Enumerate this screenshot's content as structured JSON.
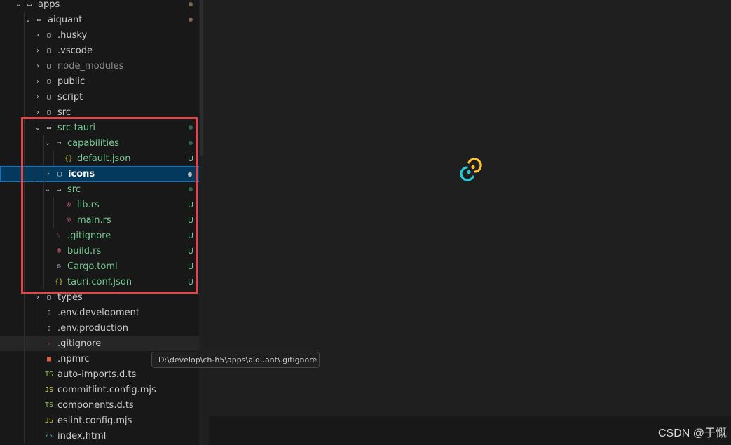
{
  "explorer": {
    "rows": [
      {
        "label": "apps",
        "twisty": "⌄",
        "kind": "folder-open",
        "status": "dot",
        "status_color": "#7a6a4f",
        "style": "normal"
      },
      {
        "label": "aiquant",
        "twisty": "⌄",
        "kind": "folder-open",
        "status": "dot",
        "status_color": "#7a6a4f",
        "style": "normal"
      },
      {
        "label": ".husky",
        "twisty": "›",
        "kind": "folder",
        "status": "",
        "style": "normal"
      },
      {
        "label": ".vscode",
        "twisty": "›",
        "kind": "folder",
        "status": "",
        "style": "normal"
      },
      {
        "label": "node_modules",
        "twisty": "›",
        "kind": "folder",
        "status": "",
        "style": "git-ignored"
      },
      {
        "label": "public",
        "twisty": "›",
        "kind": "folder",
        "status": "",
        "style": "normal"
      },
      {
        "label": "script",
        "twisty": "›",
        "kind": "folder",
        "status": "",
        "style": "normal"
      },
      {
        "label": "src",
        "twisty": "›",
        "kind": "folder",
        "status": "",
        "style": "normal"
      },
      {
        "label": "src-tauri",
        "twisty": "⌄",
        "kind": "folder-open",
        "status": "dot",
        "status_color": "#2f6a4a",
        "style": "git-u"
      },
      {
        "label": "capabilities",
        "twisty": "⌄",
        "kind": "folder-open",
        "status": "dot",
        "status_color": "#2f6a4a",
        "style": "git-u"
      },
      {
        "label": "default.json",
        "twisty": "",
        "kind": "json",
        "status": "U",
        "style": "git-u"
      },
      {
        "label": "icons",
        "twisty": "›",
        "kind": "folder",
        "status": "dot",
        "status_color": "#bdbdbd",
        "style": "bold"
      },
      {
        "label": "src",
        "twisty": "⌄",
        "kind": "folder-open",
        "status": "dot",
        "status_color": "#2f6a4a",
        "style": "git-u"
      },
      {
        "label": "lib.rs",
        "twisty": "",
        "kind": "rust",
        "status": "U",
        "style": "git-u"
      },
      {
        "label": "main.rs",
        "twisty": "",
        "kind": "rust",
        "status": "U",
        "style": "git-u"
      },
      {
        "label": ".gitignore",
        "twisty": "",
        "kind": "git",
        "status": "U",
        "style": "git-u"
      },
      {
        "label": "build.rs",
        "twisty": "",
        "kind": "rust",
        "status": "U",
        "style": "git-u"
      },
      {
        "label": "Cargo.toml",
        "twisty": "",
        "kind": "gear",
        "status": "U",
        "style": "git-u"
      },
      {
        "label": "tauri.conf.json",
        "twisty": "",
        "kind": "json",
        "status": "U",
        "style": "git-u"
      },
      {
        "label": "types",
        "twisty": "›",
        "kind": "folder",
        "status": "",
        "style": "normal"
      },
      {
        "label": ".env.development",
        "twisty": "",
        "kind": "file",
        "status": "",
        "style": "normal"
      },
      {
        "label": ".env.production",
        "twisty": "",
        "kind": "file",
        "status": "",
        "style": "normal"
      },
      {
        "label": ".gitignore",
        "twisty": "",
        "kind": "git",
        "status": "",
        "style": "normal"
      },
      {
        "label": ".npmrc",
        "twisty": "",
        "kind": "npm",
        "status": "",
        "style": "normal"
      },
      {
        "label": "auto-imports.d.ts",
        "twisty": "",
        "kind": "ts",
        "status": "",
        "style": "normal"
      },
      {
        "label": "commitlint.config.mjs",
        "twisty": "",
        "kind": "js",
        "status": "",
        "style": "normal"
      },
      {
        "label": "components.d.ts",
        "twisty": "",
        "kind": "ts",
        "status": "",
        "style": "normal"
      },
      {
        "label": "eslint.config.mjs",
        "twisty": "",
        "kind": "js",
        "status": "",
        "style": "normal"
      },
      {
        "label": "index.html",
        "twisty": "",
        "kind": "html",
        "status": "",
        "style": "normal"
      }
    ]
  },
  "tooltip": {
    "text": "D:\\develop\\ch-h5\\apps\\aiquant\\.gitignore"
  },
  "watermark": {
    "text": "CSDN @于慨"
  },
  "colors": {
    "highlight_box": "#e0474c",
    "selection": "#04395e",
    "git_untracked": "#73c991",
    "ignored": "#8c8c8c"
  }
}
